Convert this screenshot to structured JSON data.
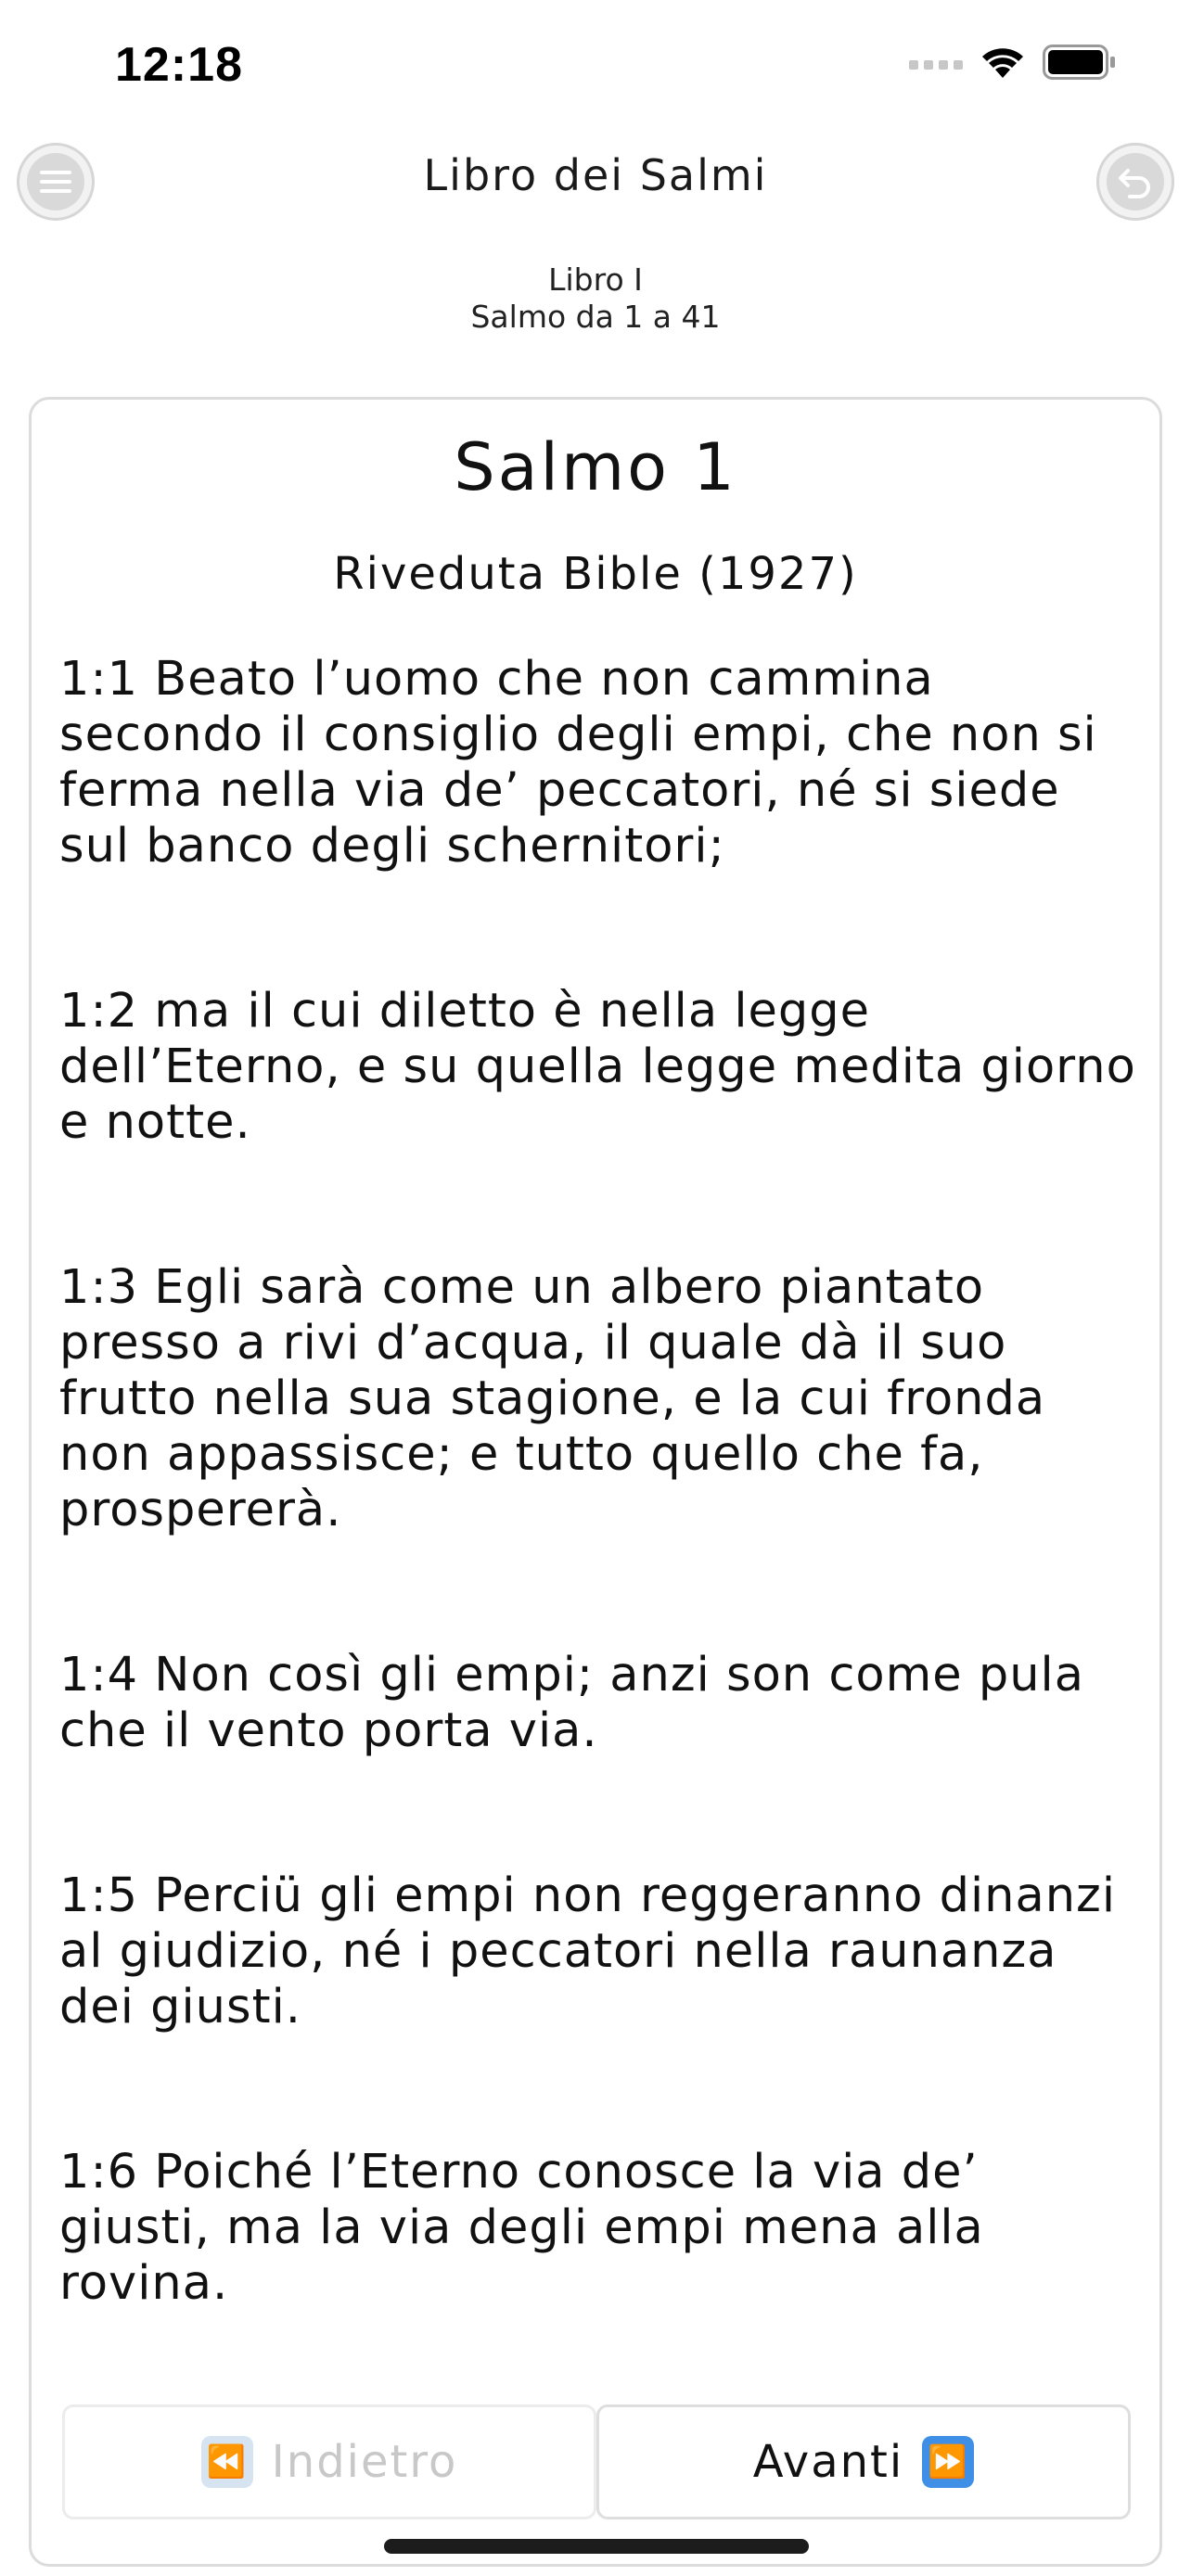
{
  "status_bar": {
    "time": "12:18"
  },
  "header": {
    "title": "Libro dei Salmi",
    "menu_icon": "hamburger-menu-icon",
    "back_icon": "undo-arrow-icon"
  },
  "subtitle": {
    "line1": "Libro I",
    "line2": "Salmo da 1 a 41"
  },
  "card": {
    "title": "Salmo 1",
    "version": "Riveduta Bible (1927)",
    "verses": [
      "1:1 Beato l’uomo che non cammina secondo il consiglio degli empi, che non si ferma nella via de’ peccatori, né si siede sul banco degli schernitori;",
      "1:2 ma il cui diletto è nella legge dell’Eterno, e su quella legge medita giorno e notte.",
      "1:3 Egli sarà come un albero piantato presso a rivi d’acqua, il quale dà il suo frutto nella sua stagione, e la cui fronda non appassisce; e tutto quello che fa, prospererà.",
      "1:4 Non così gli empi; anzi son come pula che il vento porta via.",
      "1:5 Perciü gli empi non reggeranno dinanzi al giudizio, né i peccatori nella raunanza dei giusti.",
      "1:6 Poiché l’Eterno conosce la via de’ giusti, ma la via degli empi mena alla rovina."
    ]
  },
  "nav": {
    "prev_label": "Indietro",
    "prev_icon": "⏪",
    "next_label": "Avanti",
    "next_icon": "⏩"
  },
  "colors": {
    "next_icon_bg": "#3f8fe6",
    "prev_icon_bg": "#d6e4f2",
    "disabled_text": "#c8c8c8"
  }
}
